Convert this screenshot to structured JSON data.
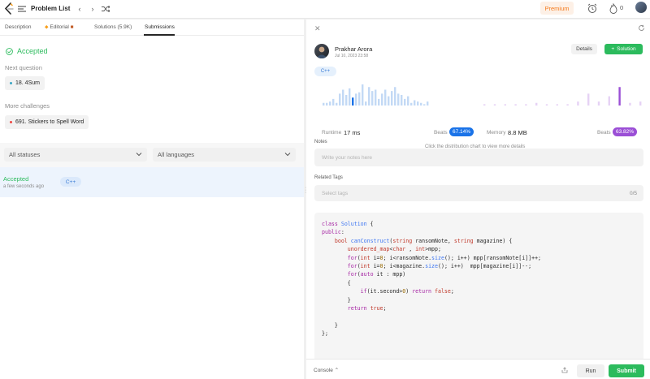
{
  "header": {
    "title": "Problem List",
    "premium_label": "Premium",
    "streak_count": "0",
    "colors": {
      "premium_bg": "#fdf0e6",
      "premium_text": "#f57b1e"
    }
  },
  "left_tabs": [
    {
      "label": "Description",
      "active": false
    },
    {
      "label": "Editorial",
      "active": false
    },
    {
      "label": "Solutions (5.9K)",
      "active": false
    },
    {
      "label": "Submissions",
      "active": true
    }
  ],
  "result": {
    "status": "Accepted",
    "next_question_label": "Next question",
    "next_question": "18. 4Sum",
    "more_challenges_label": "More challenges",
    "more_challenge": "691. Stickers to Spell Word"
  },
  "filters": {
    "status_select": "All statuses",
    "language_select": "All languages"
  },
  "submissions": [
    {
      "status": "Accepted",
      "time": "a few seconds ago",
      "language": "C++"
    }
  ],
  "detail": {
    "author": "Prakhar Arora",
    "date": "Jul 10, 2023 23:58",
    "details_label": "Details",
    "solution_label": "Solution",
    "language": "C++",
    "runtime_label": "Runtime",
    "runtime_value": "17 ms",
    "runtime_beats_label": "Beats",
    "runtime_beats": "67.14%",
    "memory_label": "Memory",
    "memory_value": "8.8 MB",
    "memory_beats_label": "Beats",
    "memory_beats": "63.82%",
    "hint": "Click the distribution chart to view more details",
    "notes_label": "Notes",
    "notes_placeholder": "Write your notes here",
    "tags_label": "Related Tags",
    "tags_placeholder": "Select tags",
    "tags_count": "0/5",
    "colors": {
      "runtime_accent": "#1a73e8",
      "memory_accent": "#9b4fd6",
      "accepted": "#2cbb5d"
    }
  },
  "runtime_distribution": [
    2,
    2,
    3,
    5,
    2,
    9,
    12,
    8,
    13,
    6,
    9,
    10,
    16,
    3,
    14,
    11,
    12,
    5,
    9,
    12,
    7,
    11,
    14,
    9,
    8,
    5,
    7,
    2,
    4,
    3,
    2,
    1,
    3
  ],
  "runtime_selected_index": 9,
  "memory_distribution": [
    1,
    1,
    1,
    1,
    1,
    2,
    1,
    1,
    1,
    3,
    9,
    3,
    7,
    14,
    2,
    3,
    1
  ],
  "memory_selected_index": 13,
  "code_lines": [
    "class Solution {",
    "public:",
    "    bool canConstruct(string ransomNote, string magazine) {",
    "        unordered_map<char , int>mpp;",
    "        for(int i=0; i<ransomNote.size(); i++) mpp[ransomNote[i]]++;",
    "        for(int i=0; i<magazine.size(); i++)  mpp[magazine[i]]--;",
    "        for(auto it : mpp)",
    "        {",
    "            if(it.second>0) return false;",
    "        }",
    "        return true;",
    "",
    "    }",
    "};"
  ],
  "bottom": {
    "console_label": "Console",
    "run_label": "Run",
    "submit_label": "Submit"
  }
}
